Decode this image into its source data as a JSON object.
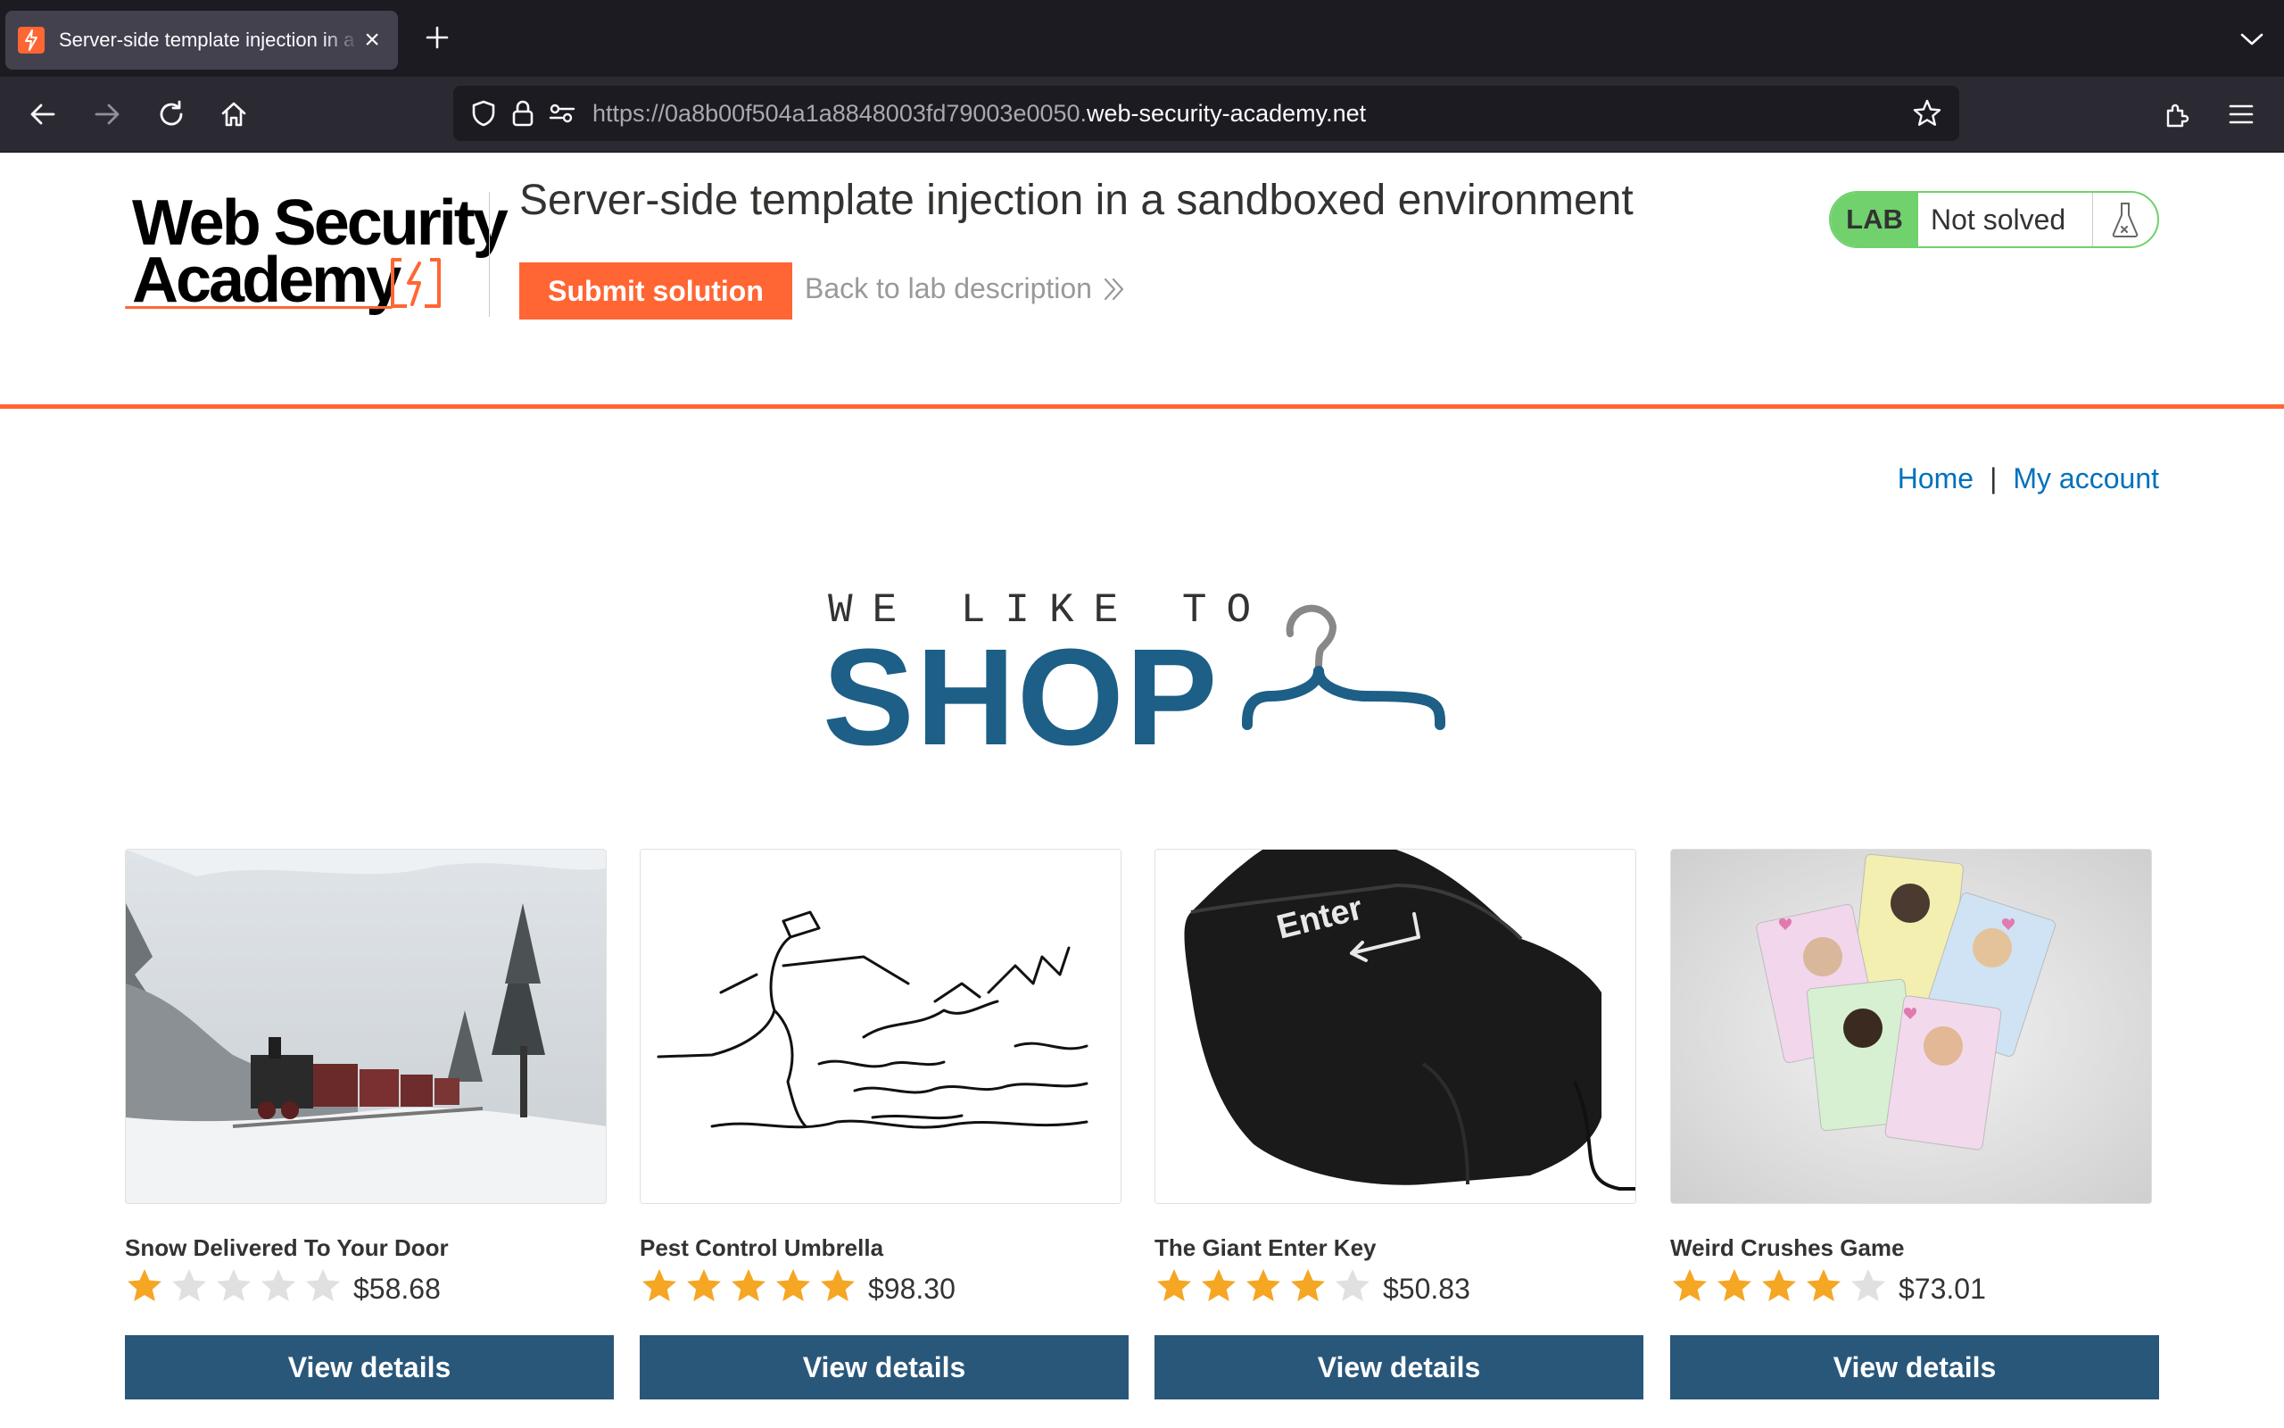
{
  "browser": {
    "tab_title": "Server-side template injection in a sandboxed environment",
    "url_prefix": "https://0a8b00f504a1a8848003fd79003e0050.",
    "url_domain": "web-security-academy.net"
  },
  "academy": {
    "logo_line1": "Web Security",
    "logo_line2": "Academy",
    "lab_title": "Server-side template injection in a sandboxed environment",
    "submit_label": "Submit solution",
    "back_label": "Back to lab description",
    "lab_badge": "LAB",
    "lab_status": "Not solved",
    "accent_color": "#ff6633",
    "status_color": "#70d16d"
  },
  "nav": {
    "home": "Home",
    "separator": "|",
    "my_account": "My account"
  },
  "banner": {
    "small": "WE LIKE TO",
    "big": "SHOP"
  },
  "products": [
    {
      "name": "Snow Delivered To Your Door",
      "rating": 1,
      "price": "$58.68",
      "button": "View details",
      "image": "snow-train"
    },
    {
      "name": "Pest Control Umbrella",
      "rating": 5,
      "price": "$98.30",
      "button": "View details",
      "image": "umbrella-sketch"
    },
    {
      "name": "The Giant Enter Key",
      "rating": 4,
      "price": "$50.83",
      "button": "View details",
      "image": "enter-key"
    },
    {
      "name": "Weird Crushes Game",
      "rating": 4,
      "price": "$73.01",
      "button": "View details",
      "image": "crush-cards"
    }
  ],
  "enter_key_label": "Enter",
  "colors": {
    "star_on": "#f5a623",
    "star_off": "#e0e0e0",
    "button_blue": "#29577a",
    "banner_blue": "#1d5f86"
  }
}
